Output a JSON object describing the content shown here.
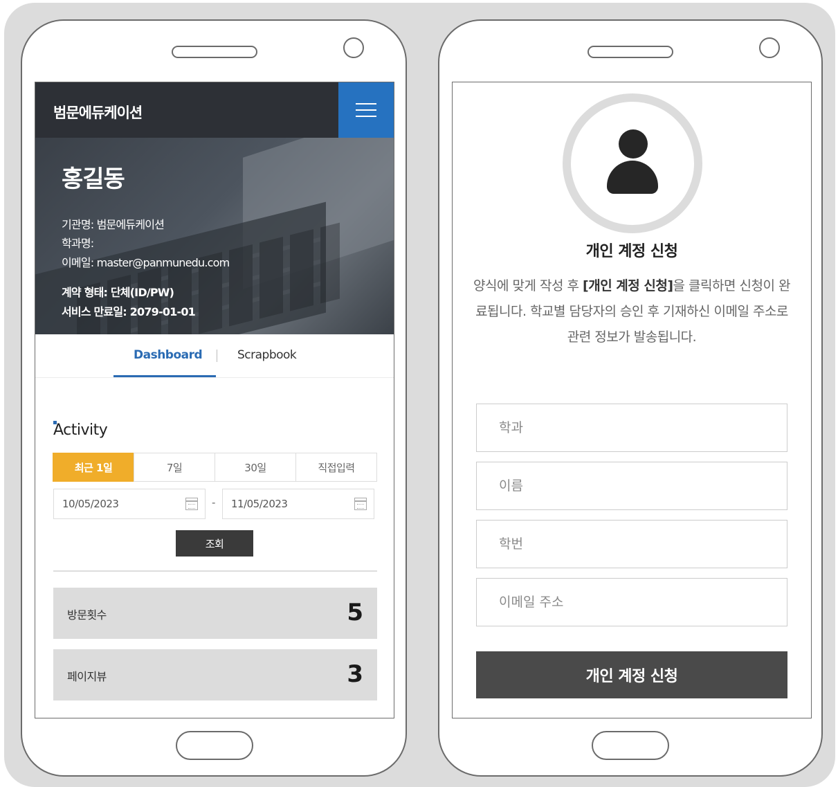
{
  "left_screen": {
    "brand": "범문에듀케이션",
    "profile": {
      "name": "홍길동",
      "institution": "기관명: 범문에듀케이션",
      "department": "학과명:",
      "email": "이메일: master@panmunedu.com",
      "contract_type": "계약 형태: 단체(ID/PW)",
      "expiry": "서비스 만료일: 2079-01-01"
    },
    "tabs": [
      "Dashboard",
      "Scrapbook"
    ],
    "activity": {
      "title": "Activity",
      "periods": [
        "최근 1일",
        "7일",
        "30일",
        "직접입력"
      ],
      "selected_period": "최근 1일",
      "start_date": "10/05/2023",
      "date_separator": "-",
      "end_date": "11/05/2023",
      "query_button": "조회",
      "stats": [
        {
          "label": "방문횟수",
          "value": "5"
        },
        {
          "label": "페이지뷰",
          "value": "3"
        }
      ]
    },
    "colors": {
      "accent_blue": "#2a6bb3",
      "menu_blue": "#2672c0",
      "period_active": "#f0ad2a",
      "topbar": "#2d3036"
    }
  },
  "right_screen": {
    "title": "개인 계정 신청",
    "description_pre": "양식에 맞게 작성 후 ",
    "description_bold": "[개인 계정 신청]",
    "description_post": "을 클릭하면 신청이 완료됩니다. 학교별 담당자의 승인 후 기재하신 이메일 주소로 관련 정보가 발송됩니다.",
    "fields": [
      {
        "placeholder": "학과"
      },
      {
        "placeholder": "이름"
      },
      {
        "placeholder": "학번"
      },
      {
        "placeholder": "이메일 주소"
      }
    ],
    "submit_button": "개인 계정 신청",
    "icons": [
      "user-avatar-icon"
    ]
  }
}
